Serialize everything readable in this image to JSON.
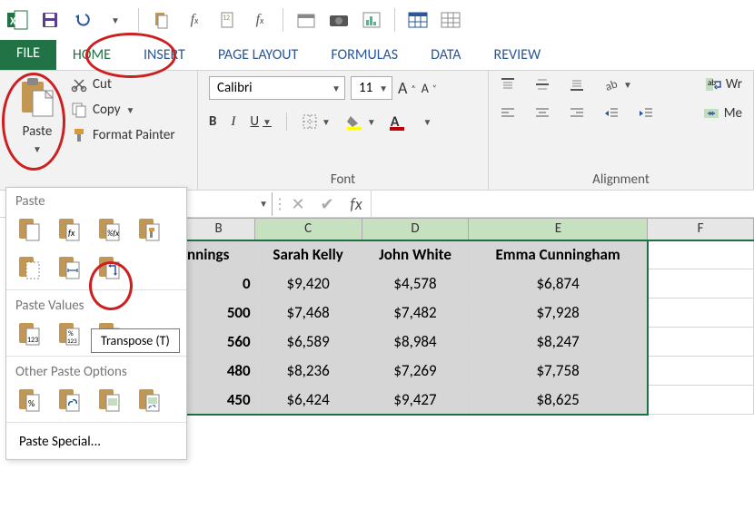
{
  "qat": {
    "save_icon": "save-icon",
    "undo_icon": "undo-icon",
    "redo_icon": "redo-icon"
  },
  "tabs": {
    "file": "FILE",
    "home": "HOME",
    "insert": "INSERT",
    "page_layout": "PAGE LAYOUT",
    "formulas": "FORMULAS",
    "data": "DATA",
    "review": "REVIEW"
  },
  "ribbon": {
    "clipboard": {
      "paste_label": "Paste",
      "cut_label": "Cut",
      "copy_label": "Copy",
      "format_painter_label": "Format Painter"
    },
    "font": {
      "group_label": "Font",
      "name_value": "Calibri",
      "size_value": "11",
      "grow_icon": "A",
      "shrink_icon": "A",
      "bold": "B",
      "italic": "I",
      "underline": "U"
    },
    "alignment": {
      "group_label": "Alignment",
      "wrap_label": "Wr",
      "merge_label": "Me"
    }
  },
  "fbar": {
    "name_box": "",
    "cancel": "✕",
    "enter": "✔",
    "fx": "fx"
  },
  "paste_menu": {
    "paste_section": "Paste",
    "values_section": "Paste Values",
    "other_section": "Other Paste Options",
    "special_label": "Paste Special...",
    "tooltip": "Transpose (T)"
  },
  "sheet": {
    "columns": [
      "B",
      "C",
      "D",
      "E",
      "F"
    ],
    "header_row": {
      "b": "nnings",
      "c": "Sarah Kelly",
      "d": "John White",
      "e": "Emma Cunningham"
    },
    "rows": [
      {
        "b": "0",
        "c": "$9,420",
        "d": "$4,578",
        "e": "$6,874"
      },
      {
        "b": "500",
        "c": "$7,468",
        "d": "$7,482",
        "e": "$7,928"
      },
      {
        "b": "560",
        "c": "$6,589",
        "d": "$8,984",
        "e": "$8,247"
      },
      {
        "b": "480",
        "c": "$8,236",
        "d": "$7,269",
        "e": "$7,758"
      },
      {
        "b": "450",
        "c": "$6,424",
        "d": "$9,427",
        "e": "$8,625"
      }
    ]
  },
  "colors": {
    "excel_green": "#217346",
    "accent_blue": "#2b579a",
    "annotation_red": "#cc2020"
  }
}
